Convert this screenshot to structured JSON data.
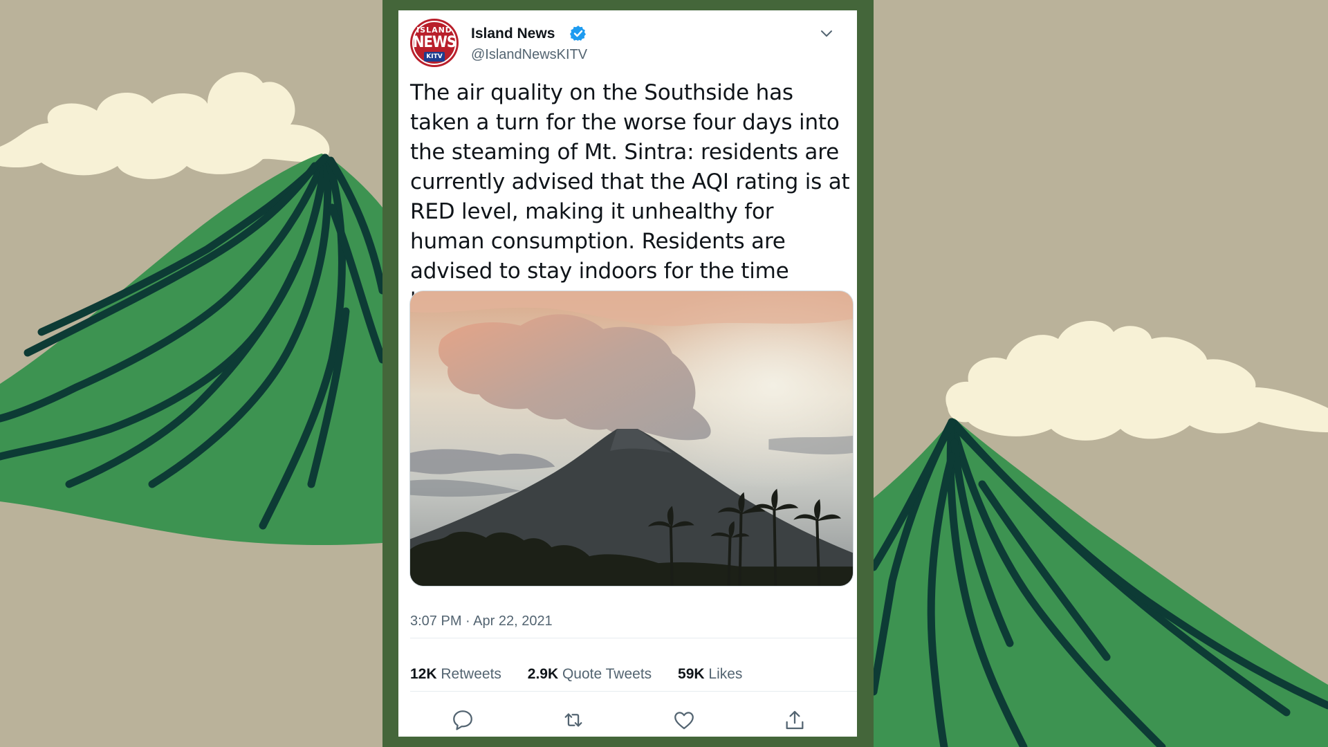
{
  "tweet": {
    "author": {
      "name": "Island News",
      "handle": "@IslandNewsKITV",
      "verified": true,
      "avatar_logo": {
        "top": "ISLAND",
        "middle": "NEWS",
        "bottom": "KITV"
      }
    },
    "text": "The air quality on the Southside has taken a turn for the worse four days into the steaming of Mt. Sintra: residents are currently advised that the AQI rating is at RED level, making it unhealthy for human consumption. Residents are advised to stay indoors for the time being.",
    "timestamp": "3:07 PM · Apr 22, 2021",
    "stats": {
      "retweets_count": "12K",
      "retweets_label": "Retweets",
      "quotes_count": "2.9K",
      "quotes_label": "Quote Tweets",
      "likes_count": "59K",
      "likes_label": "Likes"
    },
    "actions": [
      "reply-icon",
      "retweet-icon",
      "like-icon",
      "share-icon"
    ]
  },
  "colors": {
    "background": "#bab29a",
    "frame": "#44663a",
    "volcano_green": "#3d9351",
    "volcano_dark": "#0d3b35",
    "smoke": "#f7f1d6",
    "verified_blue": "#1d9bf0",
    "icon_gray": "#536471"
  }
}
